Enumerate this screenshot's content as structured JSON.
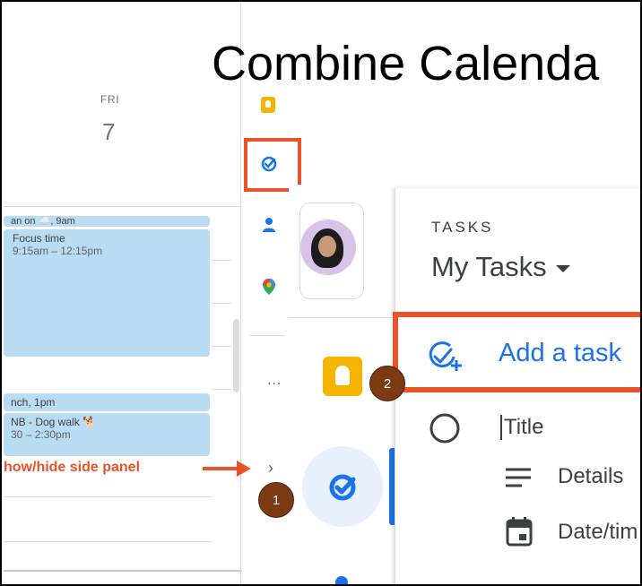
{
  "slide": {
    "title": "Combine Calenda"
  },
  "calendar": {
    "day_name": "FRI",
    "day_number": "7",
    "events": [
      {
        "title": "an on ☁️, 9am",
        "time": ""
      },
      {
        "title": "Focus time",
        "time": "9:15am – 12:15pm"
      },
      {
        "title": "nch, 1pm",
        "time": ""
      },
      {
        "title": "NB - Dog walk 🐕",
        "time": "30 – 2:30pm"
      }
    ]
  },
  "annotation": {
    "label": "how/hide side panel"
  },
  "side_panel": {
    "more": "...",
    "chevron": "›"
  },
  "badges": [
    "1",
    "2"
  ],
  "tasks_panel": {
    "header": "TASKS",
    "list_name": "My Tasks",
    "add_task": "Add a task",
    "title_placeholder": "Title",
    "details_label": "Details",
    "date_label": "Date/tim"
  },
  "colors": {
    "accent": "#1a73e8",
    "highlight": "#e8532b",
    "event": "#b9dcf2",
    "keep": "#f4b400"
  }
}
